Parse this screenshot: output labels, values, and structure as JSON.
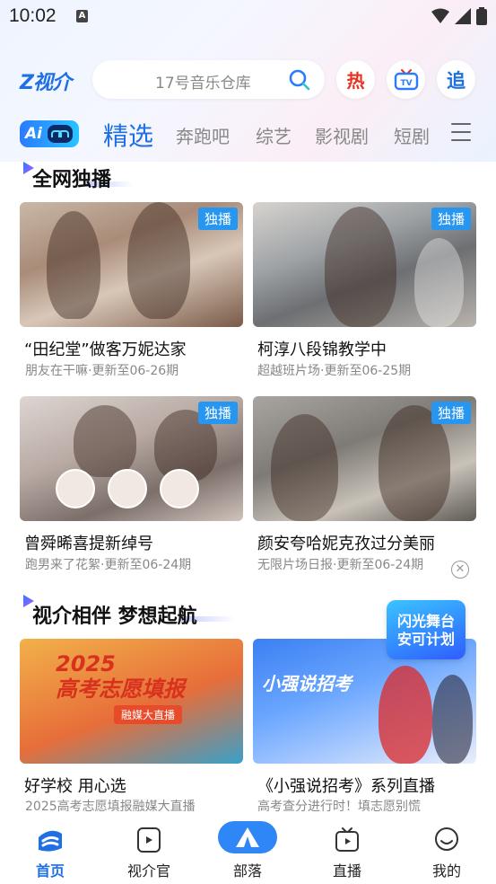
{
  "status_bar": {
    "time": "10:02",
    "notification_letter": "A"
  },
  "header": {
    "logo_text": "Z视介",
    "search": {
      "placeholder": "17号音乐仓库"
    },
    "hot_icon_text": "热",
    "chase_icon_text": "追"
  },
  "tabs": {
    "ai_label": "Ai",
    "items": [
      {
        "label": "精选",
        "active": true
      },
      {
        "label": "奔跑吧"
      },
      {
        "label": "综艺"
      },
      {
        "label": "影视剧"
      },
      {
        "label": "短剧"
      }
    ]
  },
  "sections": [
    {
      "title": "全网独播",
      "cards": [
        {
          "badge": "独播",
          "title": "“田纪堂”做客万妮达家",
          "subtitle": "朋友在干嘛·更新至06-26期"
        },
        {
          "badge": "独播",
          "title": "柯淳八段锦教学中",
          "subtitle": "超越班片场·更新至06-25期"
        },
        {
          "badge": "独播",
          "title": "曾舜晞喜提新绰号",
          "subtitle": "跑男来了花絮·更新至06-24期"
        },
        {
          "badge": "独播",
          "title": "颜安夸哈妮克孜过分美丽",
          "subtitle": "无限片场日报·更新至06-24期"
        }
      ]
    },
    {
      "title": "视介相伴 梦想起航",
      "cards": [
        {
          "title": "好学校 用心选",
          "subtitle": "2025高考志愿填报融媒大直播",
          "image_text": "2025\n高考志愿填报",
          "image_subtext": "融媒大直播"
        },
        {
          "title": "《小强说招考》系列直播",
          "subtitle": "高考查分进行时！填志愿别慌",
          "image_text": "小强说招考"
        }
      ]
    }
  ],
  "floating_banner": {
    "line1": "闪光舞台",
    "line2": "安可计划"
  },
  "bottom_nav": [
    {
      "label": "首页",
      "active": true
    },
    {
      "label": "视介官"
    },
    {
      "label": "部落"
    },
    {
      "label": "直播"
    },
    {
      "label": "我的"
    }
  ],
  "colors": {
    "accent": "#1f6fe5",
    "badge": "#2696f0",
    "hot": "#e8321f"
  }
}
